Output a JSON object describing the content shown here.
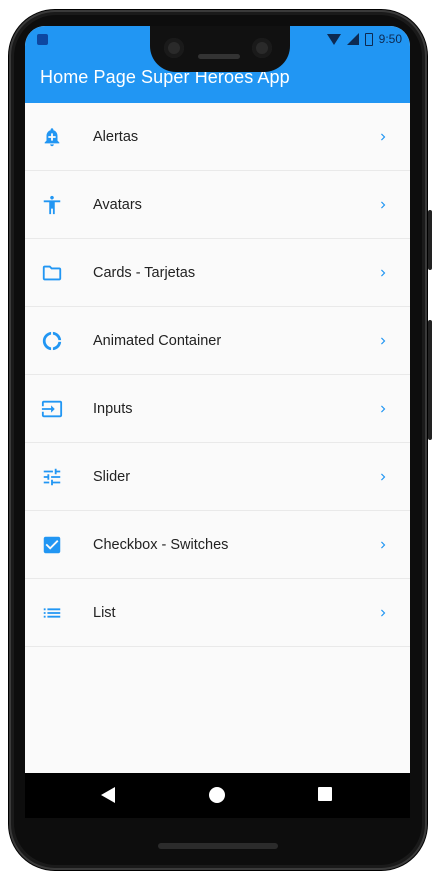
{
  "status_bar": {
    "time": "9:50"
  },
  "appbar": {
    "title": "Home Page Super Heroes App"
  },
  "colors": {
    "primary": "#2196f3",
    "icon": "#2196f3"
  },
  "menu": {
    "items": [
      {
        "label": "Alertas",
        "icon": "notification-add-icon"
      },
      {
        "label": "Avatars",
        "icon": "accessibility-icon"
      },
      {
        "label": "Cards - Tarjetas",
        "icon": "folder-icon"
      },
      {
        "label": "Animated Container",
        "icon": "donut-large-icon"
      },
      {
        "label": "Inputs",
        "icon": "input-icon"
      },
      {
        "label": "Slider",
        "icon": "tune-icon"
      },
      {
        "label": "Checkbox - Switches",
        "icon": "check-box-icon"
      },
      {
        "label": "List",
        "icon": "list-icon"
      }
    ]
  },
  "navigation": {
    "back": "back-icon",
    "home": "home-icon",
    "recents": "recents-icon"
  }
}
